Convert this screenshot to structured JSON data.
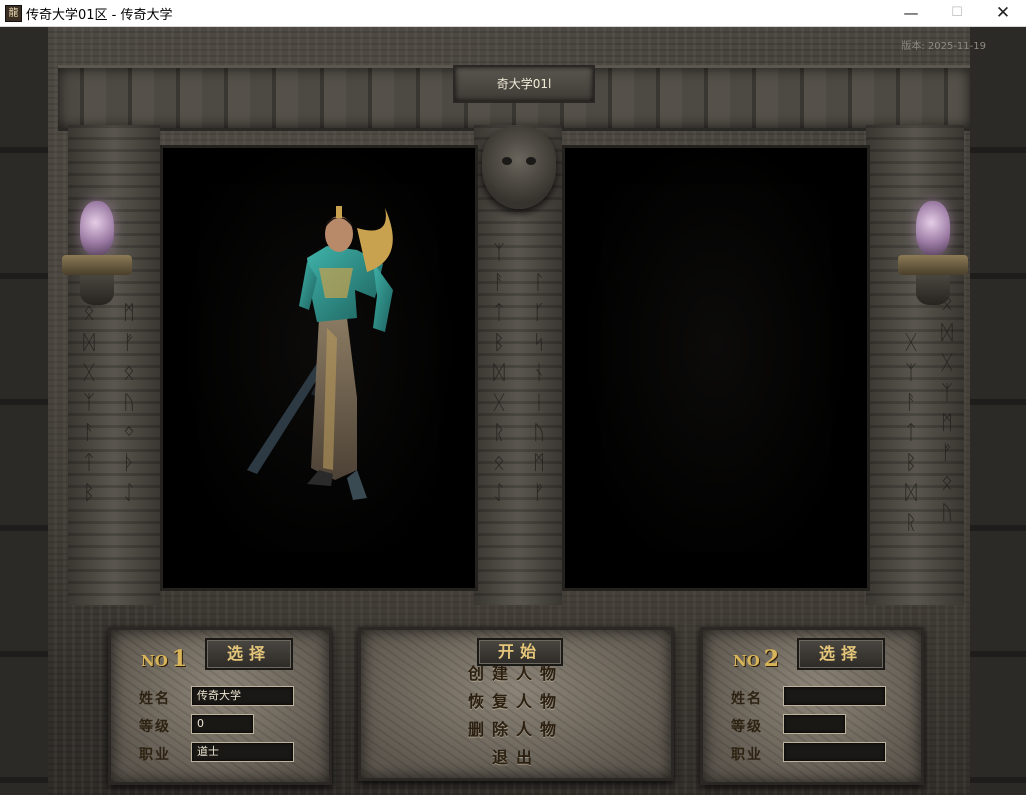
{
  "window": {
    "title": "传奇大学01区 - 传奇大学",
    "icon_glyph": "龍",
    "minimize": "—",
    "maximize": "☐",
    "close": "✕"
  },
  "game": {
    "version": "版本: 2025-11-19",
    "server_name": "奇大学01l"
  },
  "slot1": {
    "no_label": "NO",
    "no_number": "1",
    "select_label": "选择",
    "name_label": "姓名",
    "name_value": "传奇大学",
    "level_label": "等级",
    "level_value": "0",
    "class_label": "职业",
    "class_value": "道士"
  },
  "slot2": {
    "no_label": "NO",
    "no_number": "2",
    "select_label": "选择",
    "name_label": "姓名",
    "name_value": "",
    "level_label": "等级",
    "level_value": "",
    "class_label": "职业",
    "class_value": ""
  },
  "menu": {
    "start": "开始",
    "create": "创建人物",
    "restore": "恢复人物",
    "delete": "删除人物",
    "exit": "退出"
  },
  "colors": {
    "gold_text": "#e6c77a",
    "engraved_text": "#2a1f10",
    "robe_teal": "#2a8f8a"
  }
}
